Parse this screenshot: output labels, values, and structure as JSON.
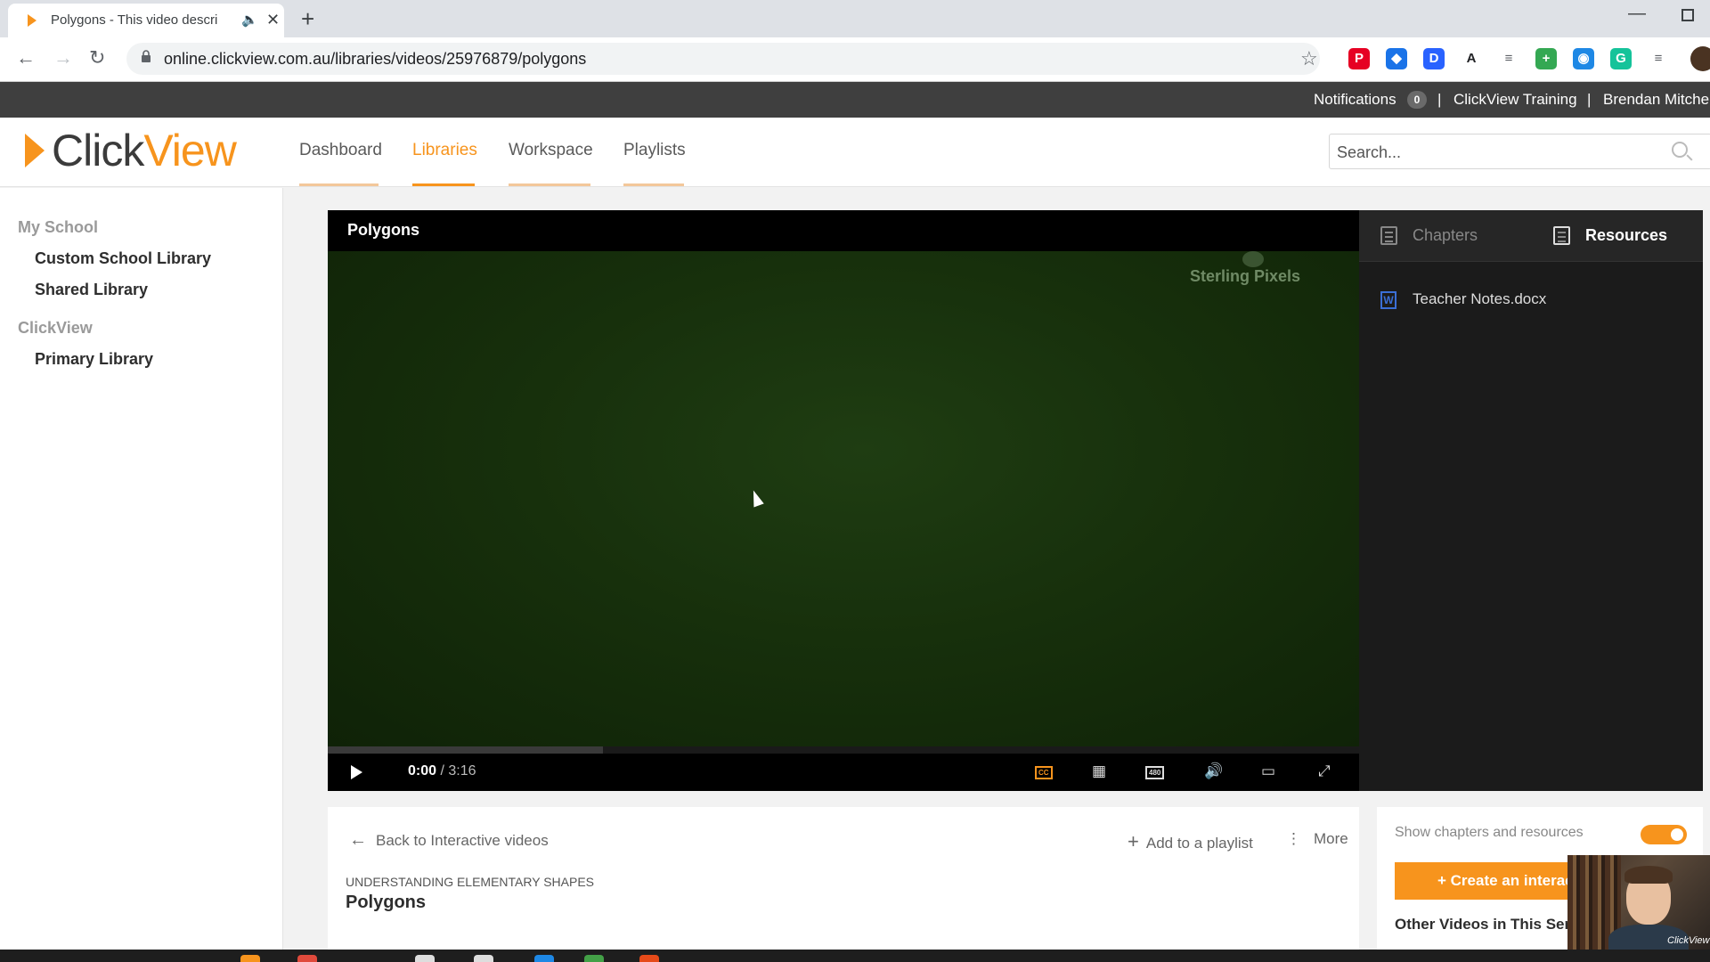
{
  "browser": {
    "tab_title": "Polygons - This video descri",
    "url": "online.clickview.com.au/libraries/videos/25976879/polygons",
    "extensions": [
      {
        "name": "pinterest-icon",
        "glyph": "P",
        "color": "#e60023"
      },
      {
        "name": "extension-blue-icon",
        "glyph": "◆",
        "color": "#1a73e8"
      },
      {
        "name": "dictionary-icon",
        "glyph": "D",
        "color": "#2962ff"
      },
      {
        "name": "font-icon",
        "glyph": "A",
        "color": "#202124"
      },
      {
        "name": "reader-icon",
        "glyph": "≡",
        "color": "#5f6368"
      },
      {
        "name": "plus-extension-icon",
        "glyph": "+",
        "color": "#34a853"
      },
      {
        "name": "globe-extension-icon",
        "glyph": "◉",
        "color": "#1e88e5"
      },
      {
        "name": "grammarly-icon",
        "glyph": "G",
        "color": "#15c39a"
      },
      {
        "name": "media-queue-icon",
        "glyph": "≡",
        "color": "#5f6368"
      }
    ]
  },
  "topbar": {
    "notifications_label": "Notifications",
    "notifications_count": "0",
    "separator": "|",
    "training_label": "ClickView Training",
    "user_name": "Brendan Mitchell"
  },
  "header": {
    "logo_click": "Click",
    "logo_view": "View",
    "nav": [
      "Dashboard",
      "Libraries",
      "Workspace",
      "Playlists"
    ],
    "active_nav": "Libraries",
    "search_placeholder": "Search..."
  },
  "sidebar": {
    "sections": [
      {
        "heading": "My School",
        "items": [
          "Custom School Library",
          "Shared Library"
        ]
      },
      {
        "heading": "ClickView",
        "items": [
          "Primary Library"
        ]
      }
    ]
  },
  "player": {
    "title": "Polygons",
    "watermark": "Sterling Pixels",
    "current_time": "0:00",
    "time_separator": "/",
    "duration": "3:16",
    "buffered_fraction": 0.267,
    "quality_label": "480"
  },
  "right_panel": {
    "tabs": [
      "Chapters",
      "Resources"
    ],
    "active_tab": "Resources",
    "resources": [
      {
        "icon": "W",
        "name": "Teacher Notes.docx"
      }
    ]
  },
  "info": {
    "back_label": "Back to Interactive videos",
    "add_playlist_label": "Add to a playlist",
    "more_label": "More",
    "series": "UNDERSTANDING ELEMENTARY SHAPES",
    "title": "Polygons"
  },
  "side_info": {
    "toggle_label": "Show chapters and resources",
    "toggle_on": true,
    "create_label": "+ Create an interactive video",
    "other_videos_label": "Other Videos in This Series"
  },
  "webcam": {
    "tag": "ClickView"
  },
  "colors": {
    "accent": "#f7941d",
    "topbar": "#3f3f3f",
    "player_bg": "#000000"
  }
}
